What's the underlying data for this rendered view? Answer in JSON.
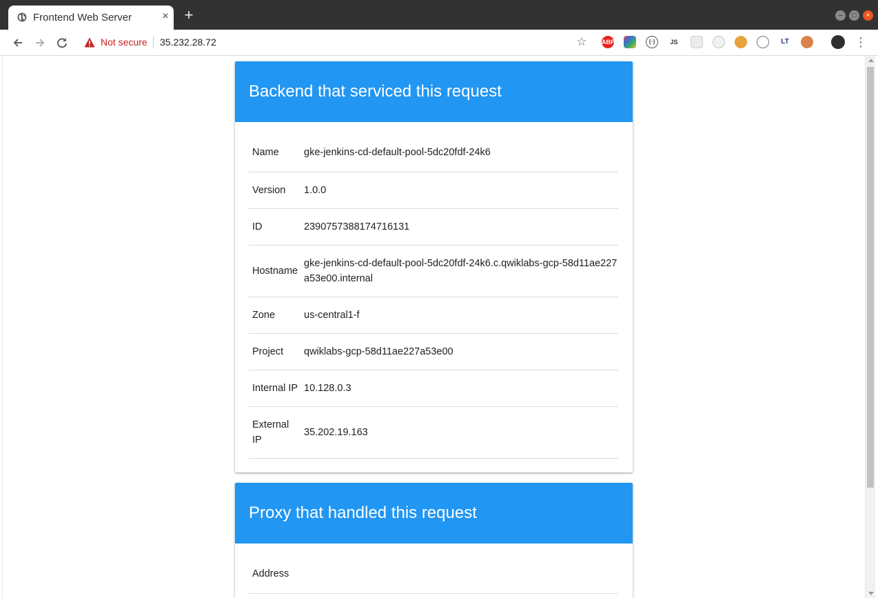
{
  "browser": {
    "tab_title": "Frontend Web Server",
    "security_label": "Not secure",
    "url": "35.232.28.72",
    "extensions": [
      {
        "name": "adblock-plus-icon",
        "label": "ABP",
        "color": "#e5231d"
      },
      {
        "name": "color-picker-icon",
        "label": "",
        "color": "#5a4b8f"
      },
      {
        "name": "json-viewer-icon",
        "label": "{·}",
        "color": "#ffffff"
      },
      {
        "name": "js-toggle-icon",
        "label": "JS",
        "color": "#ffffff"
      },
      {
        "name": "grid-ext-icon",
        "label": "",
        "color": "#e8e8e8"
      },
      {
        "name": "timer-ext-icon",
        "label": "",
        "color": "#f0f0f0"
      },
      {
        "name": "cookie-icon",
        "label": "",
        "color": "#e7a33e"
      },
      {
        "name": "network-ext-icon",
        "label": "",
        "color": "#ffffff"
      },
      {
        "name": "lt-ext-icon",
        "label": "LT",
        "color": "#ffffff"
      },
      {
        "name": "monkey-ext-icon",
        "label": "",
        "color": "#d9834a"
      },
      {
        "name": "profile-avatar",
        "label": "",
        "color": "#2e2e2e"
      }
    ]
  },
  "backend": {
    "title": "Backend that serviced this request",
    "rows": [
      {
        "key": "Name",
        "value": "gke-jenkins-cd-default-pool-5dc20fdf-24k6"
      },
      {
        "key": "Version",
        "value": "1.0.0"
      },
      {
        "key": "ID",
        "value": "2390757388174716131"
      },
      {
        "key": "Hostname",
        "value": "gke-jenkins-cd-default-pool-5dc20fdf-24k6.c.qwiklabs-gcp-58d11ae227a53e00.internal"
      },
      {
        "key": "Zone",
        "value": "us-central1-f"
      },
      {
        "key": "Project",
        "value": "qwiklabs-gcp-58d11ae227a53e00"
      },
      {
        "key": "Internal IP",
        "value": "10.128.0.3"
      },
      {
        "key": "External IP",
        "value": "35.202.19.163"
      }
    ]
  },
  "proxy": {
    "title": "Proxy that handled this request",
    "rows": [
      {
        "key": "Address",
        "value": ""
      }
    ]
  },
  "colors": {
    "header_blue": "#2196f3",
    "warning_red": "#c5221f"
  }
}
